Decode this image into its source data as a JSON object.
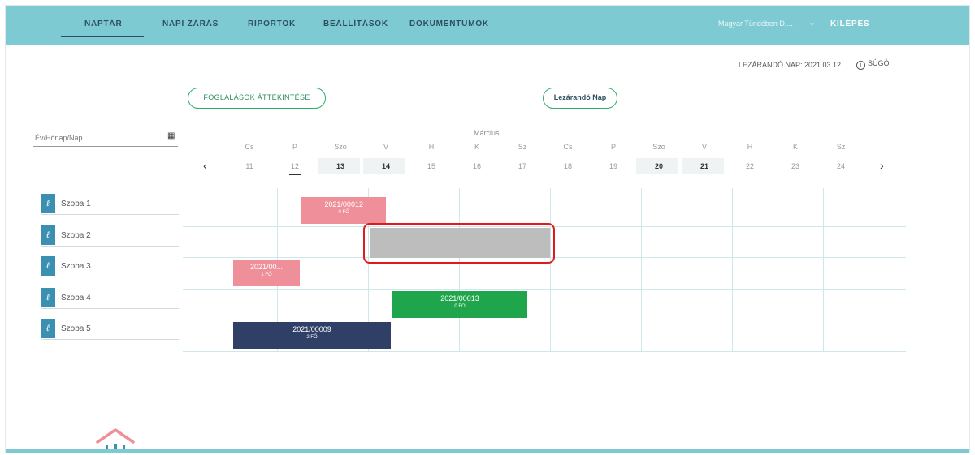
{
  "nav": {
    "items": [
      "NAPTÁR",
      "NAPI ZÁRÁS",
      "RIPORTOK",
      "BEÁLLÍTÁSOK",
      "DOKUMENTUMOK"
    ],
    "active_index": 0,
    "user_name": "Magyar Tündében D....",
    "logout_label": "KILÉPÉS"
  },
  "info": {
    "close_day": "LEZÁRANDÓ NAP: 2021.03.12.",
    "help_label": "SÚGÓ"
  },
  "buttons": {
    "overview_label": "FOGLALÁSOK ÁTTEKINTÉSE",
    "close_day_label": "Lezárandó Nap"
  },
  "date_input": {
    "placeholder": "Év/Hónap/Nap"
  },
  "timeline": {
    "month": "Március",
    "days": [
      {
        "wd": "Cs",
        "num": "11",
        "bold": false
      },
      {
        "wd": "P",
        "num": "12",
        "bold": false,
        "today": true
      },
      {
        "wd": "Szo",
        "num": "13",
        "bold": true
      },
      {
        "wd": "V",
        "num": "14",
        "bold": true
      },
      {
        "wd": "H",
        "num": "15",
        "bold": false
      },
      {
        "wd": "K",
        "num": "16",
        "bold": false
      },
      {
        "wd": "Sz",
        "num": "17",
        "bold": false
      },
      {
        "wd": "Cs",
        "num": "18",
        "bold": false
      },
      {
        "wd": "P",
        "num": "19",
        "bold": false
      },
      {
        "wd": "Szo",
        "num": "20",
        "bold": true
      },
      {
        "wd": "V",
        "num": "21",
        "bold": true
      },
      {
        "wd": "H",
        "num": "22",
        "bold": false
      },
      {
        "wd": "K",
        "num": "23",
        "bold": false
      },
      {
        "wd": "Sz",
        "num": "24",
        "bold": false
      }
    ],
    "prev_arrow": "‹",
    "next_arrow": "›"
  },
  "rooms": [
    "Szoba 1",
    "Szoba 2",
    "Szoba 3",
    "Szoba 4",
    "Szoba 5"
  ],
  "bookings": [
    {
      "id": "2021/00012",
      "count": "0 FŐ",
      "room": 0,
      "start": 2.5,
      "end": 4.4,
      "color": "#ee8f99"
    },
    {
      "id": "",
      "count": "",
      "room": 1,
      "start": 4.0,
      "end": 8.0,
      "color": "#bdbdbd"
    },
    {
      "id": "2021/00...",
      "count": "1 FŐ",
      "room": 2,
      "start": 1.0,
      "end": 2.5,
      "color": "#ee8f99"
    },
    {
      "id": "2021/00013",
      "count": "0 FŐ",
      "room": 3,
      "start": 4.5,
      "end": 7.5,
      "color": "#1fa54b"
    },
    {
      "id": "2021/00009",
      "count": "2 FŐ",
      "room": 4,
      "start": 1.0,
      "end": 4.5,
      "color": "#2f3f66"
    }
  ],
  "icons": {
    "calendar": "calendar-icon",
    "room": "key-icon",
    "help": "info-icon"
  }
}
